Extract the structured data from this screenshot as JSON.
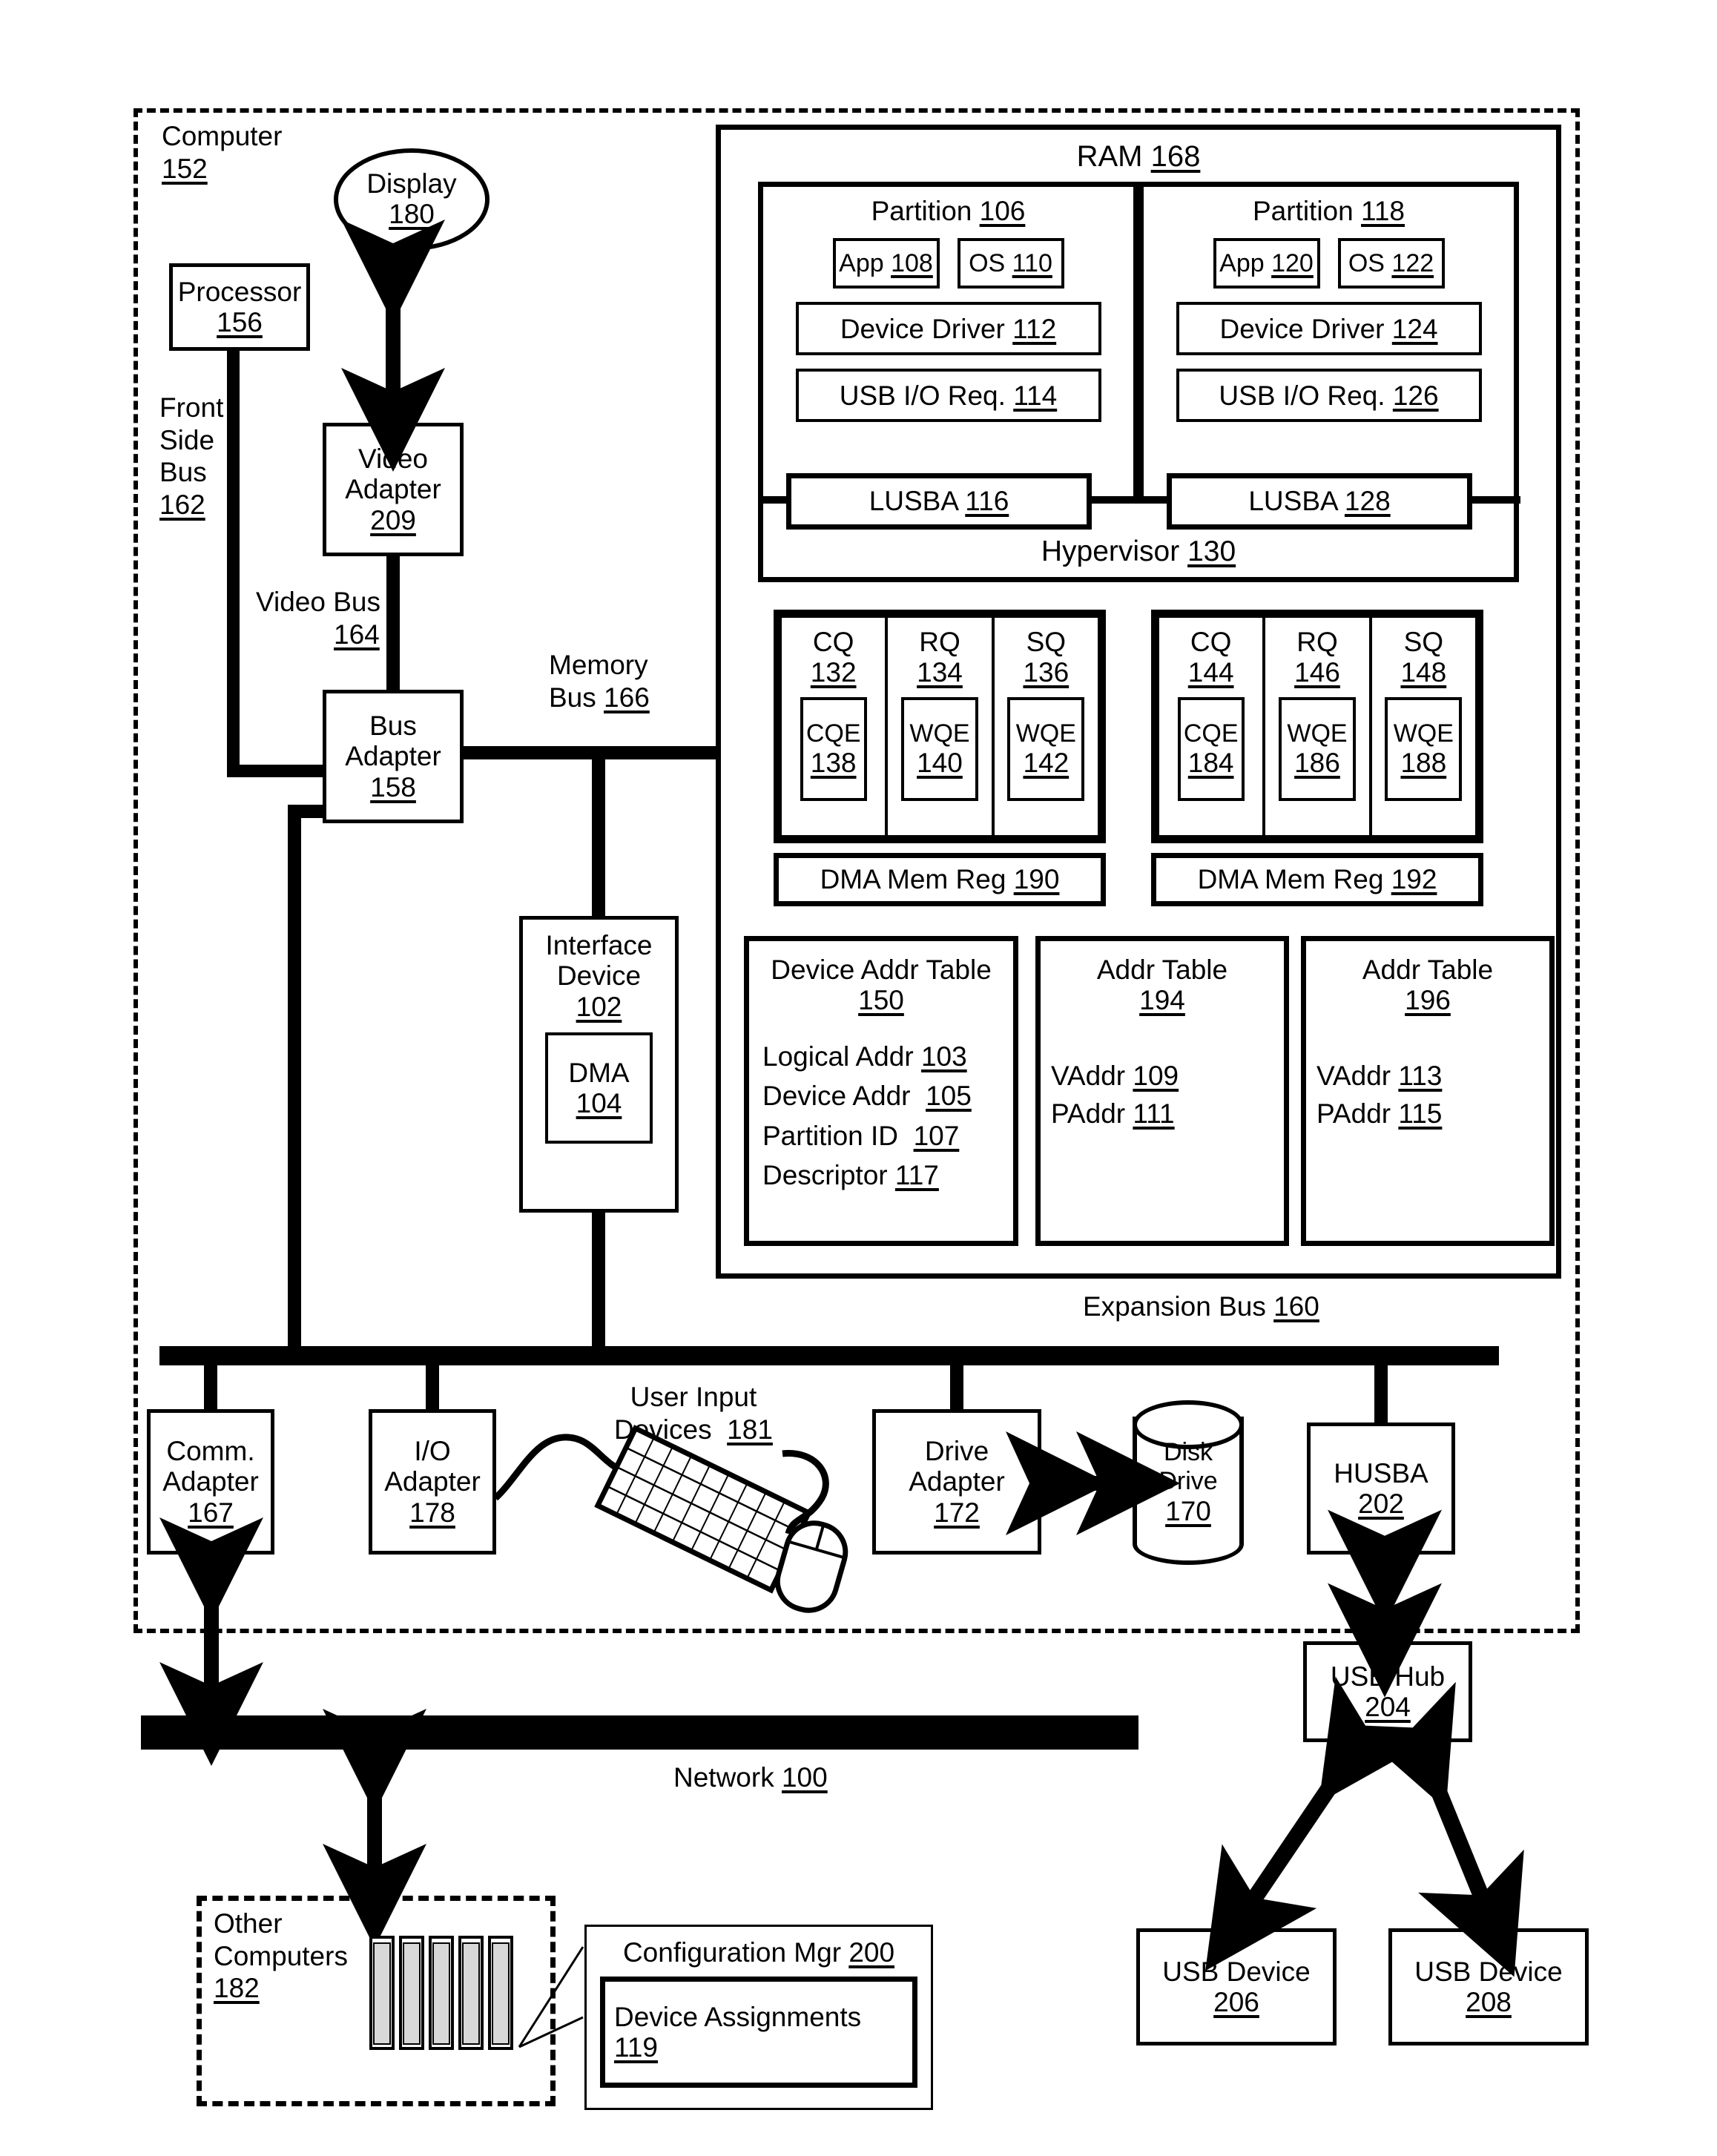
{
  "figure": {
    "computer": {
      "label": "Computer",
      "num": "152"
    },
    "display": {
      "label": "Display",
      "num": "180"
    },
    "processor": {
      "label": "Processor",
      "num": "156"
    },
    "front_side_bus": {
      "label_line1": "Front",
      "label_line2": "Side",
      "label_line3": "Bus",
      "num": "162"
    },
    "video_adapter": {
      "label_line1": "Video",
      "label_line2": "Adapter",
      "num": "209"
    },
    "video_bus": {
      "label": "Video Bus",
      "num": "164"
    },
    "memory_bus": {
      "label": "Memory",
      "label2": "Bus",
      "num": "166"
    },
    "bus_adapter": {
      "label_line1": "Bus",
      "label_line2": "Adapter",
      "num": "158"
    },
    "interface_device": {
      "label_line1": "Interface",
      "label_line2": "Device",
      "num": "102"
    },
    "dma": {
      "label": "DMA",
      "num": "104"
    },
    "expansion_bus": {
      "label": "Expansion Bus",
      "num": "160"
    },
    "ram": {
      "label": "RAM",
      "num": "168"
    },
    "hypervisor": {
      "label": "Hypervisor",
      "num": "130"
    },
    "partitions": [
      {
        "title": "Partition",
        "num": "106",
        "app": {
          "label": "App",
          "num": "108"
        },
        "os": {
          "label": "OS",
          "num": "110"
        },
        "device_driver": {
          "label": "Device Driver",
          "num": "112"
        },
        "usb_io_req": {
          "label": "USB I/O Req.",
          "num": "114"
        },
        "lusba": {
          "label": "LUSBA",
          "num": "116"
        }
      },
      {
        "title": "Partition",
        "num": "118",
        "app": {
          "label": "App",
          "num": "120"
        },
        "os": {
          "label": "OS",
          "num": "122"
        },
        "device_driver": {
          "label": "Device Driver",
          "num": "124"
        },
        "usb_io_req": {
          "label": "USB I/O Req.",
          "num": "126"
        },
        "lusba": {
          "label": "LUSBA",
          "num": "128"
        }
      }
    ],
    "queue_groups": [
      {
        "queues": [
          {
            "label": "CQ",
            "num": "132",
            "entry_label": "CQE",
            "entry_num": "138"
          },
          {
            "label": "RQ",
            "num": "134",
            "entry_label": "WQE",
            "entry_num": "140"
          },
          {
            "label": "SQ",
            "num": "136",
            "entry_label": "WQE",
            "entry_num": "142"
          }
        ],
        "dma_mem_reg": {
          "label": "DMA Mem Reg",
          "num": "190"
        }
      },
      {
        "queues": [
          {
            "label": "CQ",
            "num": "144",
            "entry_label": "CQE",
            "entry_num": "184"
          },
          {
            "label": "RQ",
            "num": "146",
            "entry_label": "WQE",
            "entry_num": "186"
          },
          {
            "label": "SQ",
            "num": "148",
            "entry_label": "WQE",
            "entry_num": "188"
          }
        ],
        "dma_mem_reg": {
          "label": "DMA Mem Reg",
          "num": "192"
        }
      }
    ],
    "device_addr_table": {
      "title": "Device Addr Table",
      "num": "150",
      "rows": [
        {
          "label": "Logical Addr",
          "num": "103"
        },
        {
          "label": "Device Addr",
          "num": "105"
        },
        {
          "label": "Partition ID",
          "num": "107"
        },
        {
          "label": "Descriptor",
          "num": "117"
        }
      ]
    },
    "addr_tables": [
      {
        "title": "Addr Table",
        "num": "194",
        "rows": [
          {
            "label": "VAddr",
            "num": "109"
          },
          {
            "label": "PAddr",
            "num": "111"
          }
        ]
      },
      {
        "title": "Addr Table",
        "num": "196",
        "rows": [
          {
            "label": "VAddr",
            "num": "113"
          },
          {
            "label": "PAddr",
            "num": "115"
          }
        ]
      }
    ],
    "comm_adapter": {
      "label_line1": "Comm.",
      "label_line2": "Adapter",
      "num": "167"
    },
    "io_adapter": {
      "label_line1": "I/O",
      "label_line2": "Adapter",
      "num": "178"
    },
    "user_input_devices": {
      "label_line1": "User Input",
      "label_line2": "Devices",
      "num": "181"
    },
    "drive_adapter": {
      "label_line1": "Drive",
      "label_line2": "Adapter",
      "num": "172"
    },
    "disk_drive": {
      "label_line1": "Disk",
      "label_line2": "Drive",
      "num": "170"
    },
    "husba": {
      "label": "HUSBA",
      "num": "202"
    },
    "network": {
      "label": "Network",
      "num": "100"
    },
    "other_computers": {
      "label_line1": "Other",
      "label_line2": "Computers",
      "num": "182"
    },
    "configuration_mgr": {
      "label": "Configuration Mgr",
      "num": "200"
    },
    "device_assignments": {
      "label": "Device Assignments",
      "num": "119"
    },
    "usb_hub": {
      "label": "USB Hub",
      "num": "204"
    },
    "usb_devices": [
      {
        "label": "USB Device",
        "num": "206"
      },
      {
        "label": "USB Device",
        "num": "208"
      }
    ],
    "icons": {
      "keyboard": "keyboard-icon",
      "mouse": "mouse-icon",
      "servers": "server-stack-icon",
      "disk": "disk-cylinder-icon"
    },
    "colors": {
      "ink": "#000000",
      "paper": "#ffffff"
    }
  }
}
